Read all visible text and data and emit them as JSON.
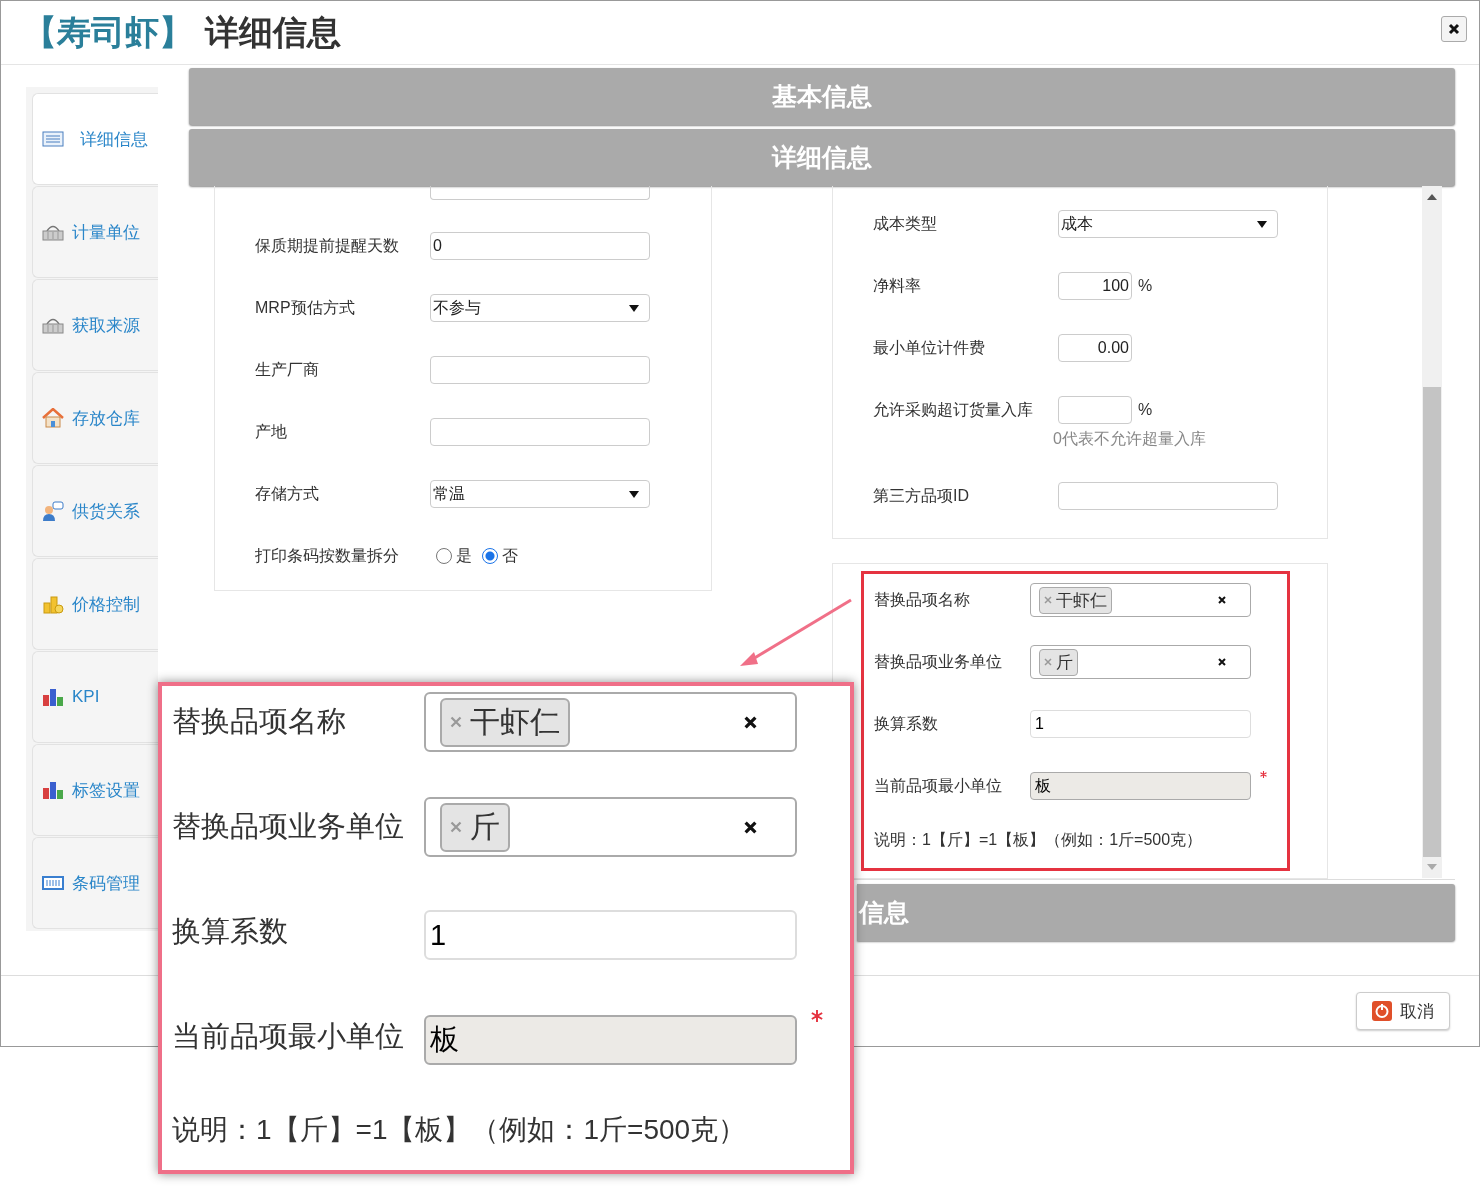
{
  "dialog": {
    "title_prefix": "【寿司虾】",
    "title": "详细信息"
  },
  "sidebar": {
    "items": [
      {
        "label": "详细信息",
        "selected": true
      },
      {
        "label": "计量单位",
        "selected": false
      },
      {
        "label": "获取来源",
        "selected": false
      },
      {
        "label": "存放仓库",
        "selected": false
      },
      {
        "label": "供货关系",
        "selected": false
      },
      {
        "label": "价格控制",
        "selected": false
      },
      {
        "label": "KPI",
        "selected": false
      },
      {
        "label": "标签设置",
        "selected": false
      },
      {
        "label": "条码管理",
        "selected": false
      }
    ]
  },
  "sections": [
    {
      "title": "基本信息"
    },
    {
      "title": "详细信息"
    }
  ],
  "left_fields": [
    {
      "label": "保质期提前提醒天数",
      "kind": "input",
      "value": "0"
    },
    {
      "label": "MRP预估方式",
      "kind": "select",
      "value": "不参与"
    },
    {
      "label": "生产厂商",
      "kind": "input"
    },
    {
      "label": "产地",
      "kind": "input"
    },
    {
      "label": "存储方式",
      "kind": "select",
      "value": "常温"
    },
    {
      "label": "打印条码按数量拆分",
      "kind": "radio",
      "options": [
        {
          "label": "是",
          "selected": false
        },
        {
          "label": "否",
          "selected": true
        }
      ]
    }
  ],
  "right_fields": [
    {
      "label": "成本类型",
      "kind": "select",
      "value": "成本"
    },
    {
      "label": "净料率",
      "kind": "short",
      "value": "100",
      "suffix": "%"
    },
    {
      "label": "最小单位计件费",
      "kind": "short",
      "value": "0.00"
    },
    {
      "label": "允许采购超订货量入库",
      "kind": "short",
      "suffix": "%",
      "hint": "0代表不允许超量入库"
    },
    {
      "label": "第三方品项ID",
      "kind": "input"
    }
  ],
  "replacement": {
    "fields": [
      {
        "label": "替换品项名称",
        "kind": "tag",
        "value": "干虾仁"
      },
      {
        "label": "替换品项业务单位",
        "kind": "tag",
        "value": "斤"
      },
      {
        "label": "换算系数",
        "kind": "input",
        "value": "1"
      },
      {
        "label": "当前品项最小单位",
        "kind": "readonly",
        "value": "板",
        "required": true
      }
    ],
    "note": "说明：1【斤】=1【板】（例如：1斤=500克）"
  },
  "callout": {
    "fields": [
      {
        "label": "替换品项名称",
        "kind": "tag",
        "value": "干虾仁"
      },
      {
        "label": "替换品项业务单位",
        "kind": "tag",
        "value": "斤"
      },
      {
        "label": "换算系数",
        "kind": "input",
        "value": "1"
      },
      {
        "label": "当前品项最小单位",
        "kind": "readonly",
        "value": "板",
        "required": true
      }
    ],
    "note": "说明：1【斤】=1【板】（例如：1斤=500克）"
  },
  "third_section": {
    "title": "信息"
  },
  "footer": {
    "cancel": "取消"
  }
}
